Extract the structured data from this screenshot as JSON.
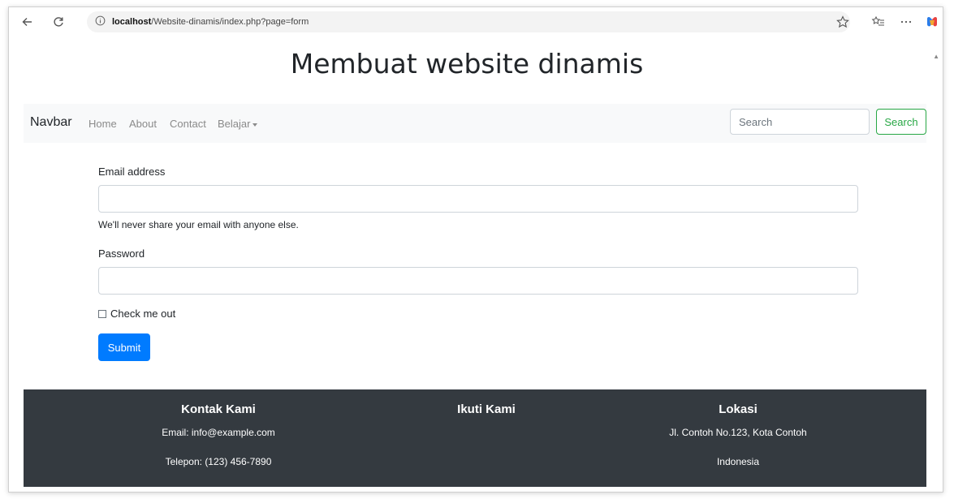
{
  "browser": {
    "url_host": "localhost",
    "url_path": "/Website-dinamis/index.php?page=form"
  },
  "page": {
    "title": "Membuat website dinamis"
  },
  "navbar": {
    "brand": "Navbar",
    "links": [
      "Home",
      "About",
      "Contact",
      "Belajar"
    ],
    "search_placeholder": "Search",
    "search_button": "Search"
  },
  "form": {
    "email_label": "Email address",
    "email_value": "",
    "email_help": "We'll never share your email with anyone else.",
    "password_label": "Password",
    "password_value": "",
    "checkbox_label": "Check me out",
    "submit_label": "Submit"
  },
  "footer": {
    "contact": {
      "heading": "Kontak Kami",
      "email": "Email: info@example.com",
      "phone": "Telepon: (123) 456-7890"
    },
    "follow": {
      "heading": "Ikuti Kami"
    },
    "location": {
      "heading": "Lokasi",
      "address": "Jl. Contoh No.123, Kota Contoh",
      "country": "Indonesia"
    }
  },
  "colors": {
    "navbar_bg": "#f8f9fa",
    "footer_bg": "#343a40",
    "primary": "#007bff",
    "success": "#28a745"
  }
}
